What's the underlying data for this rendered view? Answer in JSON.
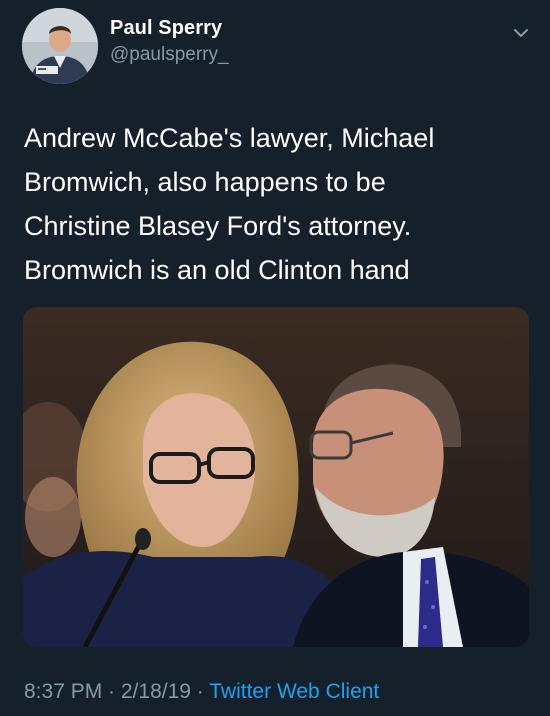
{
  "author": {
    "display_name": "Paul Sperry",
    "handle": "@paulsperry_",
    "avatar_icon": "person-avatar-icon"
  },
  "menu": {
    "icon": "chevron-down-icon"
  },
  "tweet": {
    "lines": [
      "Andrew McCabe's lawyer, Michael",
      "Bromwich, also happens to be",
      "Christine Blasey Ford's attorney.",
      "Bromwich is an old Clinton hand"
    ]
  },
  "media": {
    "type": "photo"
  },
  "footer": {
    "time": "8:37 PM",
    "separator": " · ",
    "date": "2/18/19",
    "source": "Twitter Web Client"
  },
  "colors": {
    "background": "#15202b",
    "text": "#ffffff",
    "secondary": "#8899a6",
    "link": "#1da1f2"
  }
}
